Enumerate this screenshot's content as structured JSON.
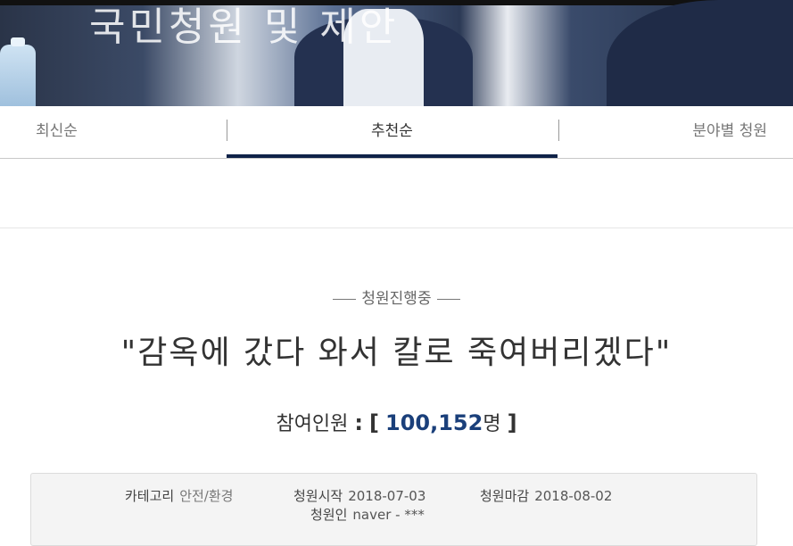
{
  "hero": {
    "title": "국민청원 및 제안"
  },
  "tabs": [
    {
      "label": "최신순",
      "active": false
    },
    {
      "label": "추천순",
      "active": true
    },
    {
      "label": "분야별 청원",
      "active": false
    }
  ],
  "petition": {
    "status": "청원진행중",
    "title": "\"감옥에 갔다 와서 칼로 죽여버리겠다\"",
    "participants_label": "참여인원",
    "participants_colon": ":",
    "bracket_open": "[",
    "participants_count": "100,152",
    "participants_unit": "명",
    "bracket_close": "]",
    "category_label": "카테고리",
    "category_value": "안전/환경",
    "start_label": "청원시작",
    "start_value": "2018-07-03",
    "end_label": "청원마감",
    "end_value": "2018-08-02",
    "author_label": "청원인",
    "author_value": "naver - ***"
  },
  "colors": {
    "accent": "#0f2248",
    "count": "#1a3f7a"
  }
}
